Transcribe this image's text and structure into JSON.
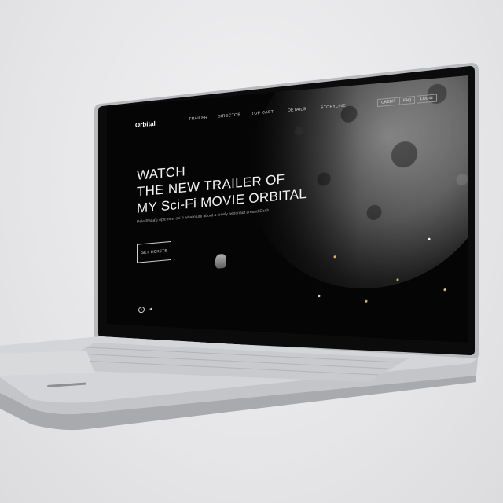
{
  "site": {
    "brand": "Orbital",
    "nav": [
      "TRAILER",
      "DIRECTOR",
      "TOP CAST",
      "DETAILS",
      "STORYLINE"
    ],
    "nav_buttons": [
      "CREDIT",
      "FAQ",
      "LOGIN"
    ]
  },
  "hero": {
    "line1": "WATCH",
    "line2": "THE NEW TRAILER OF",
    "line3": "MY Sci-Fi MOVIE ORBITAL",
    "subtitle": "Pele Rana's epic new sci-fi adventure about a lonely astronaut around Earth ...",
    "cta": "GET TICKETS"
  },
  "icons": {
    "play": "play-icon",
    "sound": "sound-icon"
  },
  "colors": {
    "page_bg": "#050506",
    "text": "#f3f3f3",
    "laptop_silver": "#c9cacd"
  }
}
